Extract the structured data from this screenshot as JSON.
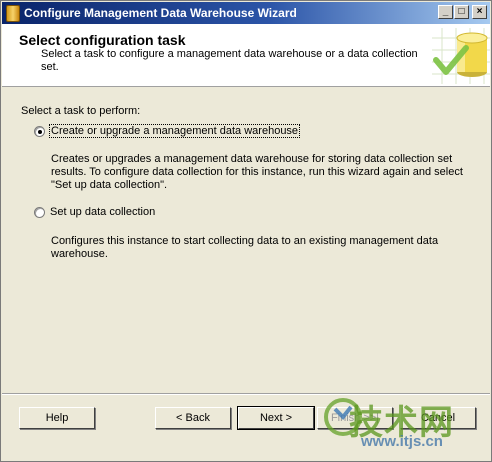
{
  "window": {
    "title": "Configure Management Data Warehouse Wizard",
    "minimize_glyph": "_",
    "maximize_glyph": "□",
    "close_glyph": "×"
  },
  "header": {
    "title": "Select configuration task",
    "description": "Select a task to configure a management data warehouse or a data collection set."
  },
  "body": {
    "task_label": "Select a task to perform:",
    "options": [
      {
        "label": "Create or upgrade a management data warehouse",
        "description": "Creates or upgrades a management data warehouse for storing data collection set results. To configure data collection for this instance, run this wizard again and select \"Set up data collection\".",
        "selected": true
      },
      {
        "label": "Set up data collection",
        "description": "Configures this instance to start collecting data to an existing management data warehouse.",
        "selected": false
      }
    ]
  },
  "footer": {
    "help": "Help",
    "back": "< Back",
    "next": "Next >",
    "finish": "Finish >>|",
    "cancel": "Cancel"
  },
  "watermark": {
    "cn_text": "技术网",
    "url": "www.itjs.cn"
  },
  "colors": {
    "titlebar_start": "#0a246a",
    "titlebar_end": "#a6caf0",
    "dialog_bg": "#ece9d8",
    "header_bg": "#ffffff"
  },
  "icons": {
    "app": "wizard-app-icon",
    "header_graphic": "database-check-icon"
  }
}
